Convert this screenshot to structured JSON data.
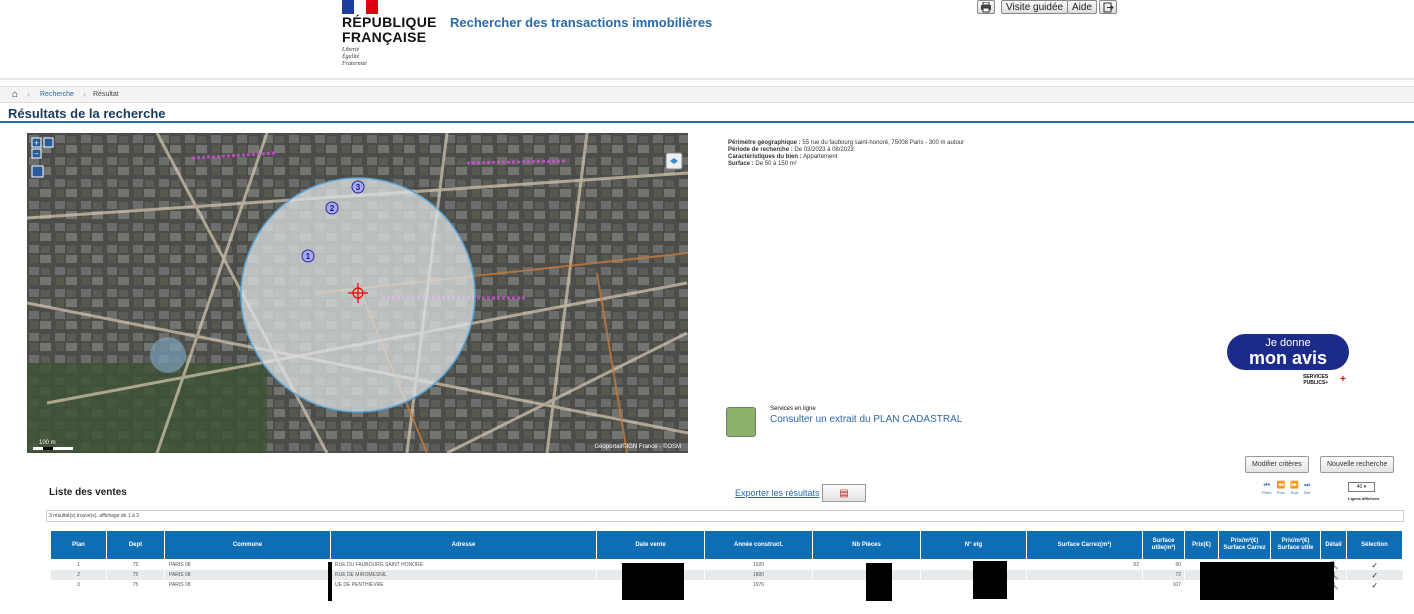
{
  "header": {
    "republic": [
      "RÉPUBLIQUE",
      "FRANÇAISE"
    ],
    "motto": [
      "Liberté",
      "Égalité",
      "Fraternité"
    ],
    "app_title": "Rechercher des transactions immobilières",
    "buttons": {
      "guided": "Visite guidée",
      "help": "Aide"
    }
  },
  "breadcrumb": {
    "search": "Recherche",
    "result": "Résultat"
  },
  "page_title": "Résultats de la recherche",
  "map": {
    "markers": [
      "1",
      "2",
      "3"
    ],
    "attribution": "Géoportail©IGN France - ©OSM",
    "scale": "100 m"
  },
  "criteria": {
    "geo_label": "Périmètre géographique :",
    "geo_value": "55 rue du faubourg saint-honoré, 75008 Paris - 300 m autour",
    "period_label": "Période de recherche :",
    "period_value": "De 03/2023 à 08/2023",
    "char_label": "Caractéristiques du bien :",
    "char_value": "Appartement",
    "surface_label": "Surface :",
    "surface_value": "De 50 à 150 m²"
  },
  "avis": {
    "line1": "Je donne",
    "line2": "mon avis",
    "brand1": "SERVICES",
    "brand2": "PUBLICS+"
  },
  "cadastre": {
    "sub": "Services en ligne",
    "link": "Consulter un extrait du PLAN CADASTRAL"
  },
  "actions": {
    "modify": "Modifier critères",
    "new_search": "Nouvelle recherche"
  },
  "list": {
    "title": "Liste des ventes",
    "export": "Exporter les résultats",
    "count": "3 résultat(s) trouvé(s), affichage de 1 à 3",
    "pager": [
      "Prem",
      "Prec",
      "Suiv",
      "Der"
    ],
    "lines_value": "40",
    "lines_label": "Lignes affichées"
  },
  "table": {
    "headers": [
      "Plan",
      "Dept",
      "Commune",
      "Adresse",
      "Date vente",
      "Année construct.",
      "Nb Pièces",
      "N° etg",
      "Surface Carrez(m²)",
      "Surface utile(m²)",
      "Prix(€)",
      "Prix/m²(€) Surface Carrez",
      "Prix/m²(€) Surface utile",
      "Détail",
      "Sélection"
    ],
    "rows": [
      {
        "plan": "1",
        "dept": "75",
        "commune": "PARIS 08",
        "adresse": "RUE DU FAUBOURG SAINT HONORE",
        "annee": "1920",
        "carrez": "62",
        "utile": "60"
      },
      {
        "plan": "2",
        "dept": "75",
        "commune": "PARIS 08",
        "adresse": "RUE DE MIROMESNIL",
        "annee": "1800",
        "carrez": "",
        "utile": "72"
      },
      {
        "plan": "3",
        "dept": "75",
        "commune": "PARIS 08",
        "adresse": "UE DE PENTHIEVRE",
        "annee": "1976",
        "carrez": "",
        "utile": "107"
      }
    ]
  },
  "colors": {
    "accent": "#0e6db3",
    "title": "#1b3a5c",
    "link": "#2a6aa8",
    "avis": "#1c2a8a"
  }
}
